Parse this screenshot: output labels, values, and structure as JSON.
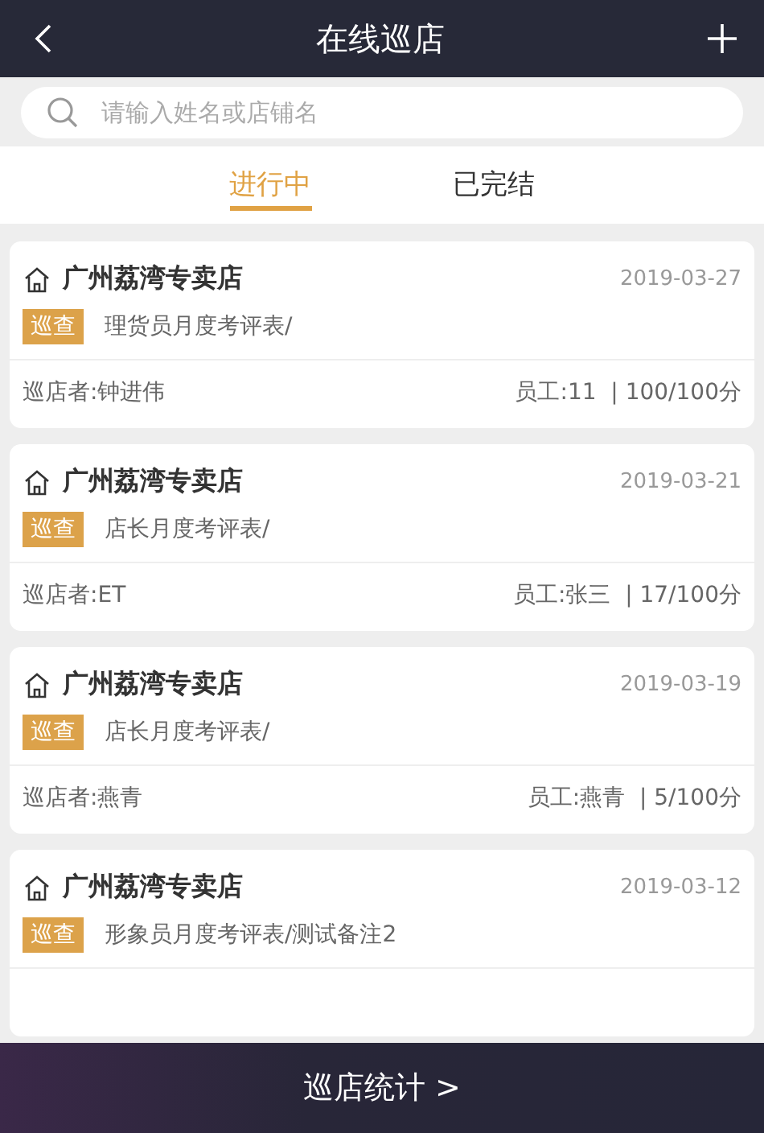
{
  "header": {
    "title": "在线巡店"
  },
  "search": {
    "placeholder": "请输入姓名或店铺名"
  },
  "tabs": [
    {
      "label": "进行中",
      "selected": true
    },
    {
      "label": "已完结",
      "selected": false
    }
  ],
  "records": [
    {
      "store": "广州荔湾专卖店",
      "date": "2019-03-27",
      "tag": "巡查",
      "form": "理货员月度考评表/",
      "inspector": "巡店者:钟进伟",
      "result": "员工:11  | 100/100分"
    },
    {
      "store": "广州荔湾专卖店",
      "date": "2019-03-21",
      "tag": "巡查",
      "form": "店长月度考评表/",
      "inspector": "巡店者:ET",
      "result": "员工:张三  | 17/100分"
    },
    {
      "store": "广州荔湾专卖店",
      "date": "2019-03-19",
      "tag": "巡查",
      "form": "店长月度考评表/",
      "inspector": "巡店者:燕青",
      "result": "员工:燕青  | 5/100分"
    },
    {
      "store": "广州荔湾专卖店",
      "date": "2019-03-12",
      "tag": "巡查",
      "form": "形象员月度考评表/测试备注2"
    }
  ],
  "bottom_button": {
    "label": "巡店统计 >"
  }
}
